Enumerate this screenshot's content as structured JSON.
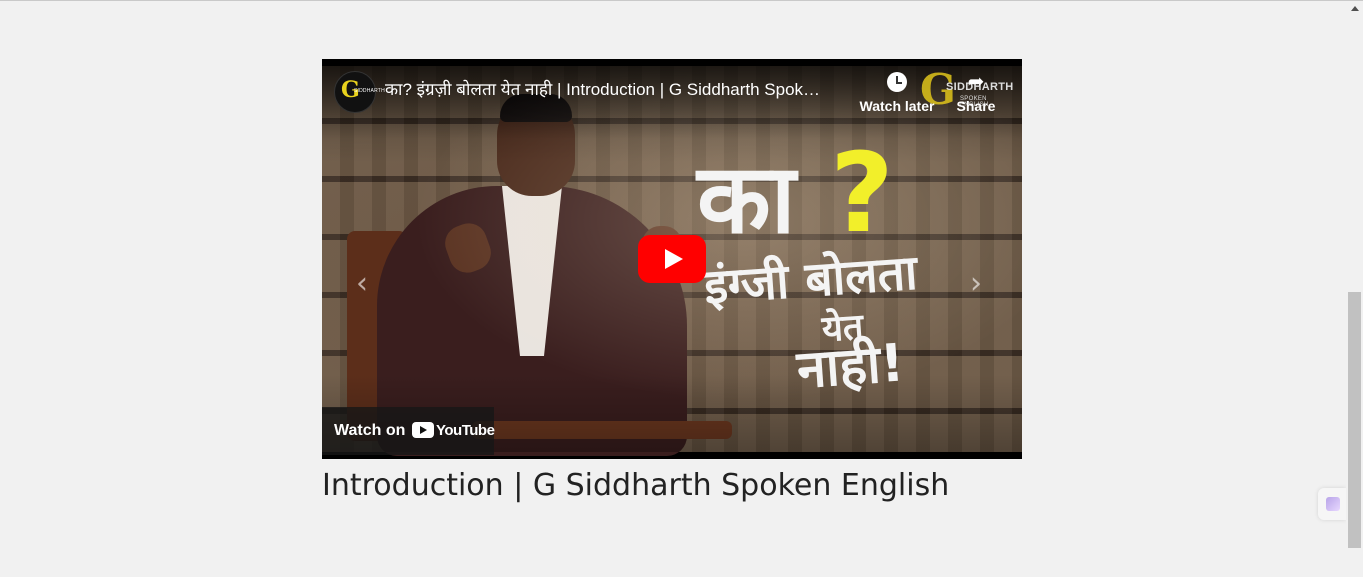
{
  "video": {
    "title": "का? इंग्रज़ी बोलता येत नाही | Introduction | G Siddharth Spok…",
    "channel_avatar_letter": "G",
    "channel_avatar_text": "SIDDHARTH",
    "watch_later_label": "Watch later",
    "share_label": "Share",
    "watermark_letter": "G",
    "watermark_name": "SIDDHARTH",
    "watermark_sub": "SPOKEN ENGLISH",
    "thumbnail_text": {
      "line1": "का",
      "question_mark": "?",
      "line2": "इंग्जी बोलता",
      "line3": "येत",
      "line4": "नाही!"
    },
    "watch_on_label": "Watch on",
    "youtube_wordmark": "YouTube",
    "nav_prev_glyph": "‹",
    "nav_next_glyph": "›",
    "share_glyph": "➦"
  },
  "page": {
    "heading": "Introduction | G Siddharth Spoken English"
  },
  "colors": {
    "page_background": "#f1f1f1",
    "play_button": "#ff0000",
    "thumbnail_accent": "#f2ef2a",
    "heading_text": "#222222"
  }
}
